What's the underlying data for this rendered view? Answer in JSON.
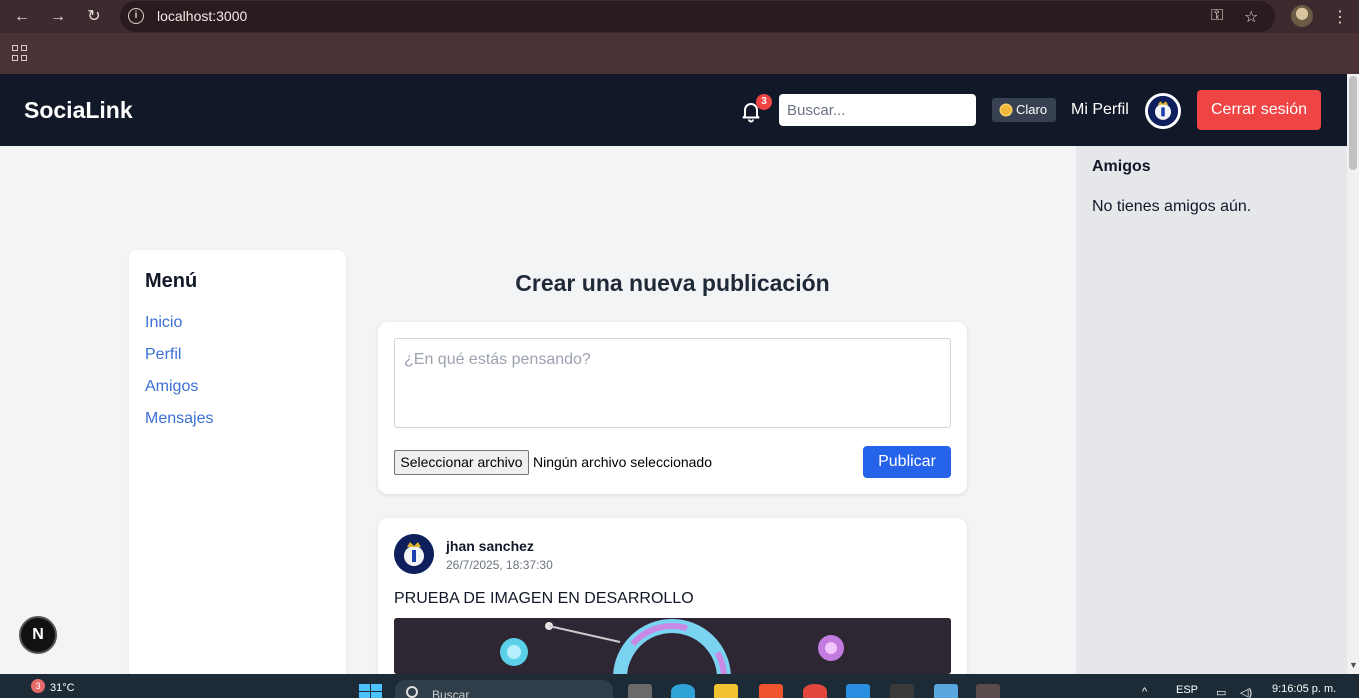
{
  "browser": {
    "url": "localhost:3000",
    "back_icon": "←",
    "forward_icon": "→",
    "reload_icon": "↻",
    "info_icon": "i",
    "key_icon": "⚿",
    "star_icon": "☆",
    "menu_icon": "⋮"
  },
  "navbar": {
    "brand": "SociaLink",
    "notification_count": "3",
    "search_placeholder": "Buscar...",
    "theme_label": "Claro",
    "profile_link": "Mi Perfil",
    "logout_label": "Cerrar sesión"
  },
  "sidebar": {
    "title": "Menú",
    "items": [
      {
        "label": "Inicio"
      },
      {
        "label": "Perfil"
      },
      {
        "label": "Amigos"
      },
      {
        "label": "Mensajes"
      }
    ]
  },
  "create_post": {
    "title": "Crear una nueva publicación",
    "placeholder": "¿En qué estás pensando?",
    "file_button": "Seleccionar archivo",
    "file_status": "Ningún archivo seleccionado",
    "publish_label": "Publicar"
  },
  "post": {
    "author": "jhan sanchez",
    "date": "26/7/2025, 18:37:30",
    "text": "PRUEBA DE IMAGEN EN DESARROLLO"
  },
  "friends": {
    "title": "Amigos",
    "empty_message": "No tienes amigos aún."
  },
  "dev_badge": "N",
  "taskbar": {
    "weather_badge": "3",
    "weather_temp": "31°C",
    "search_label": "Buscar",
    "language": "ESP",
    "time": "9:16:05 p. m."
  },
  "colors": {
    "navbar": "#111827",
    "logout": "#ef4444",
    "publish": "#2563eb",
    "link": "#3b6fd4"
  }
}
